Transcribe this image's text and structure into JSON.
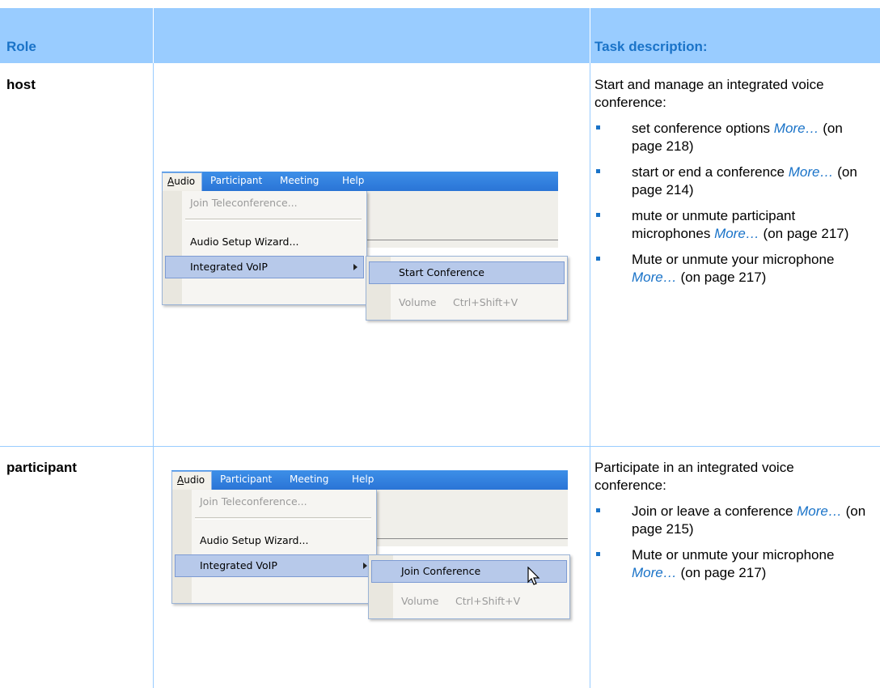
{
  "header": {
    "role_label": "Role",
    "task_label": "Task description:"
  },
  "rows": [
    {
      "role": "host",
      "intro": "Start and manage an integrated voice conference:",
      "items": [
        {
          "text": "set conference options",
          "link": "More…",
          "page": "(on page 218)"
        },
        {
          "text": "start or end a conference",
          "link": "More…",
          "page": "(on page 214)"
        },
        {
          "text": "mute or unmute participant microphones",
          "link": "More…",
          "page": "(on page 217)"
        },
        {
          "text": "Mute or unmute your microphone",
          "link": "More…",
          "page": "(on page 217)"
        }
      ],
      "menu": {
        "menubar": [
          "Audio",
          "Participant",
          "Meeting",
          "Help"
        ],
        "items": [
          "Join Teleconference...",
          "Audio Setup Wizard...",
          "Integrated VoIP"
        ],
        "submenu": [
          "Start Conference",
          "Volume"
        ],
        "shortcut": "Ctrl+Shift+V"
      }
    },
    {
      "role": "participant",
      "intro": "Participate in an integrated voice conference:",
      "items": [
        {
          "text": "Join or leave a conference",
          "link": "More…",
          "page": "(on page 215)"
        },
        {
          "text": "Mute or unmute your microphone",
          "link": "More…",
          "page": "(on page 217)"
        }
      ],
      "menu": {
        "menubar": [
          "Audio",
          "Participant",
          "Meeting",
          "Help"
        ],
        "items": [
          "Join Teleconference...",
          "Audio Setup Wizard...",
          "Integrated VoIP"
        ],
        "submenu": [
          "Join Conference",
          "Volume"
        ],
        "shortcut": "Ctrl+Shift+V"
      }
    }
  ],
  "colors": {
    "header_bg": "#99ccff",
    "header_text": "#1a73c8",
    "link": "#1a73c8",
    "menubar": "#2a74d6",
    "highlight": "#b7c9ea"
  }
}
